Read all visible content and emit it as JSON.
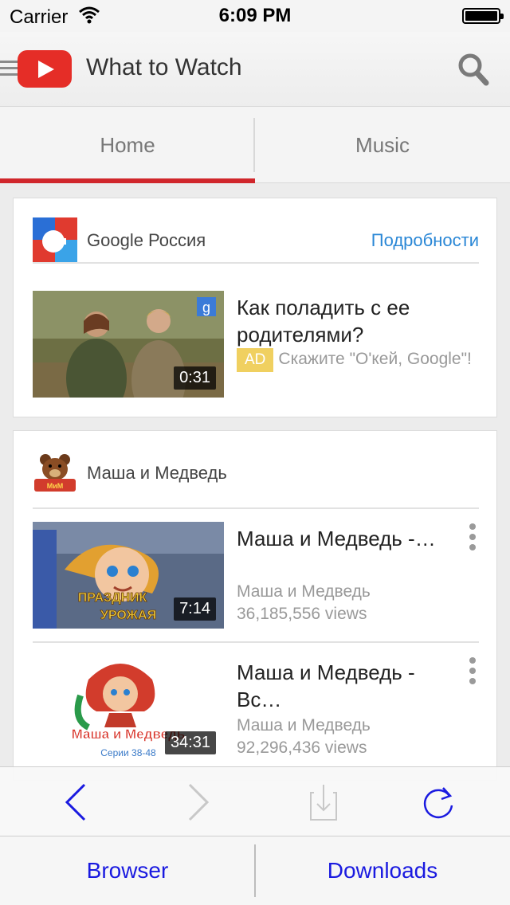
{
  "status_bar": {
    "carrier": "Carrier",
    "time": "6:09 PM",
    "icons": [
      "wifi-icon",
      "battery-icon"
    ]
  },
  "app_bar": {
    "title": "What to Watch",
    "icons": [
      "menu-icon",
      "youtube-logo-icon",
      "search-icon"
    ],
    "brand_color": "#e52d27"
  },
  "tabs": [
    {
      "label": "Home",
      "selected": true
    },
    {
      "label": "Music",
      "selected": false
    }
  ],
  "colors": {
    "accent_tab": "#d0262b",
    "link": "#2a87d6",
    "ad_badge": "#f0d060",
    "toolbar_button": "#1a1ae0"
  },
  "ad_card": {
    "channel_name": "Google Россия",
    "details_link": "Подробности",
    "video": {
      "title": "Как поладить с ее родителями?",
      "badge": "AD",
      "description": "Скажите \"О'кей, Google\"!",
      "duration": "0:31"
    }
  },
  "channel_card": {
    "channel_name": "Маша и Медведь",
    "videos": [
      {
        "title": "Маша и Медведь -…",
        "channel": "Маша и Медведь",
        "views": "36,185,556 views",
        "duration": "7:14",
        "thumb_caption_1": "ПРАЗДНИК",
        "thumb_caption_2": "УРОЖАЯ"
      },
      {
        "title": "Маша и Медведь - Вс…",
        "channel": "Маша и Медведь",
        "views": "92,296,436 views",
        "duration": "34:31",
        "thumb_caption_1": "Маша и Медведь",
        "thumb_caption_2": "Серии 38-48"
      }
    ]
  },
  "toolbar": {
    "buttons": [
      "back-icon",
      "forward-icon",
      "download-icon",
      "refresh-icon"
    ],
    "forward_enabled": false,
    "download_enabled": false
  },
  "bottom_bar": {
    "browser_label": "Browser",
    "downloads_label": "Downloads"
  }
}
